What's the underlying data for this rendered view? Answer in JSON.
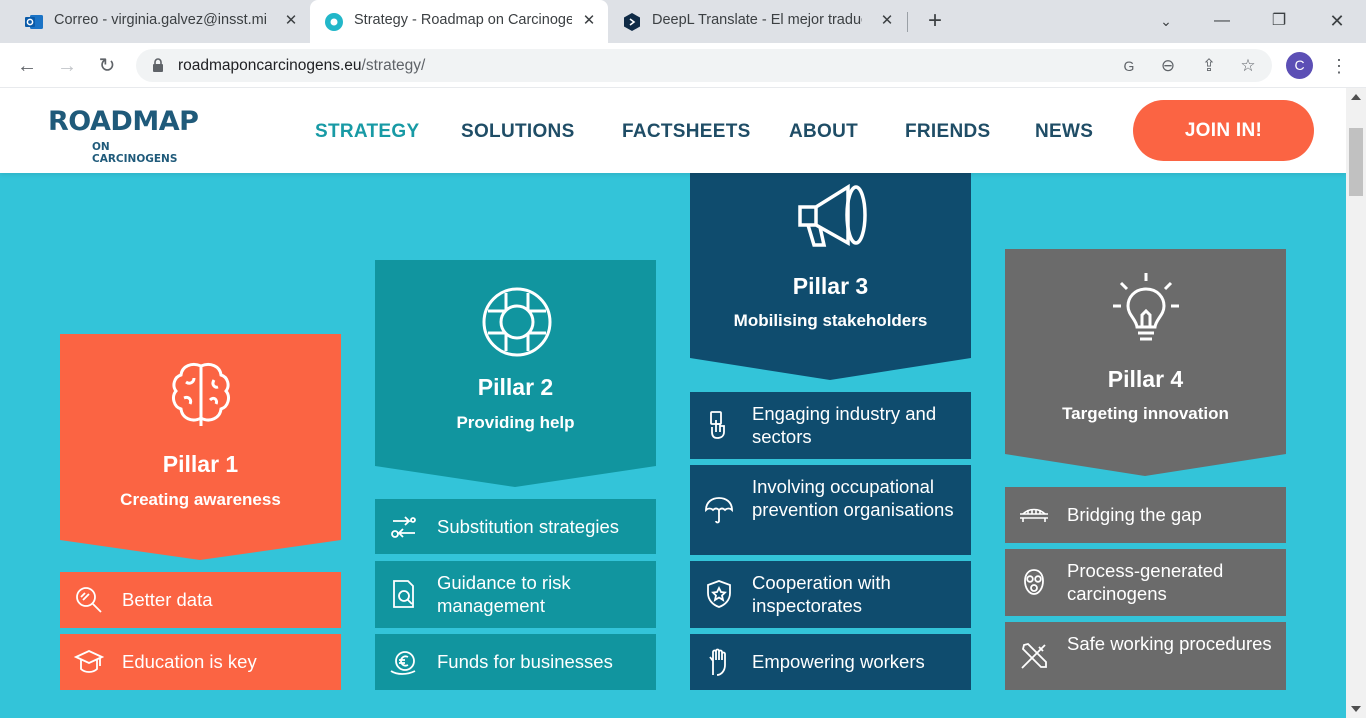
{
  "browser": {
    "tabs": [
      {
        "title": "Correo - virginia.galvez@insst.mi",
        "active": false
      },
      {
        "title": "Strategy - Roadmap on Carcinoge",
        "active": true
      },
      {
        "title": "DeepL Translate - El mejor traduc",
        "active": false
      }
    ],
    "url_domain": "roadmaponcarcinogens.eu",
    "url_path": "/strategy/",
    "profile_initial": "C"
  },
  "site": {
    "logo_main": "ROADMAP",
    "logo_sub": "ON CARCINOGENS",
    "nav": [
      "STRATEGY",
      "SOLUTIONS",
      "FACTSHEETS",
      "ABOUT",
      "FRIENDS",
      "NEWS"
    ],
    "active_nav": "STRATEGY",
    "join_label": "JOIN IN!"
  },
  "colors": {
    "background": "#33c4d9",
    "pillar1": "#fb6443",
    "pillar2": "#11959f",
    "pillar3": "#0f4c6e",
    "pillar4": "#6b6b6b"
  },
  "pillars": [
    {
      "title": "Pillar 1",
      "subtitle": "Creating awareness",
      "icon": "brain-icon",
      "items": [
        {
          "label": "Better data",
          "icon": "magnifier-icon"
        },
        {
          "label": "Education is key",
          "icon": "graduation-cap-icon"
        }
      ]
    },
    {
      "title": "Pillar 2",
      "subtitle": "Providing help",
      "icon": "lifebuoy-icon",
      "items": [
        {
          "label": "Substitution strategies",
          "icon": "swap-icon"
        },
        {
          "label": "Guidance to risk management",
          "icon": "document-search-icon"
        },
        {
          "label": "Funds for businesses",
          "icon": "euro-hand-icon"
        }
      ]
    },
    {
      "title": "Pillar 3",
      "subtitle": "Mobilising stakeholders",
      "icon": "megaphone-icon",
      "items": [
        {
          "label": "Engaging industry and sectors",
          "icon": "hand-pointer-icon"
        },
        {
          "label": "Involving occupational prevention organisations",
          "icon": "umbrella-icon"
        },
        {
          "label": "Cooperation with inspectorates",
          "icon": "shield-star-icon"
        },
        {
          "label": "Empowering workers",
          "icon": "raised-hand-icon"
        }
      ]
    },
    {
      "title": "Pillar 4",
      "subtitle": "Targeting innovation",
      "icon": "lightbulb-icon",
      "items": [
        {
          "label": "Bridging the gap",
          "icon": "bridge-icon"
        },
        {
          "label": "Process-generated carcinogens",
          "icon": "gas-mask-icon"
        },
        {
          "label": "Safe working procedures",
          "icon": "tools-icon"
        }
      ]
    }
  ]
}
